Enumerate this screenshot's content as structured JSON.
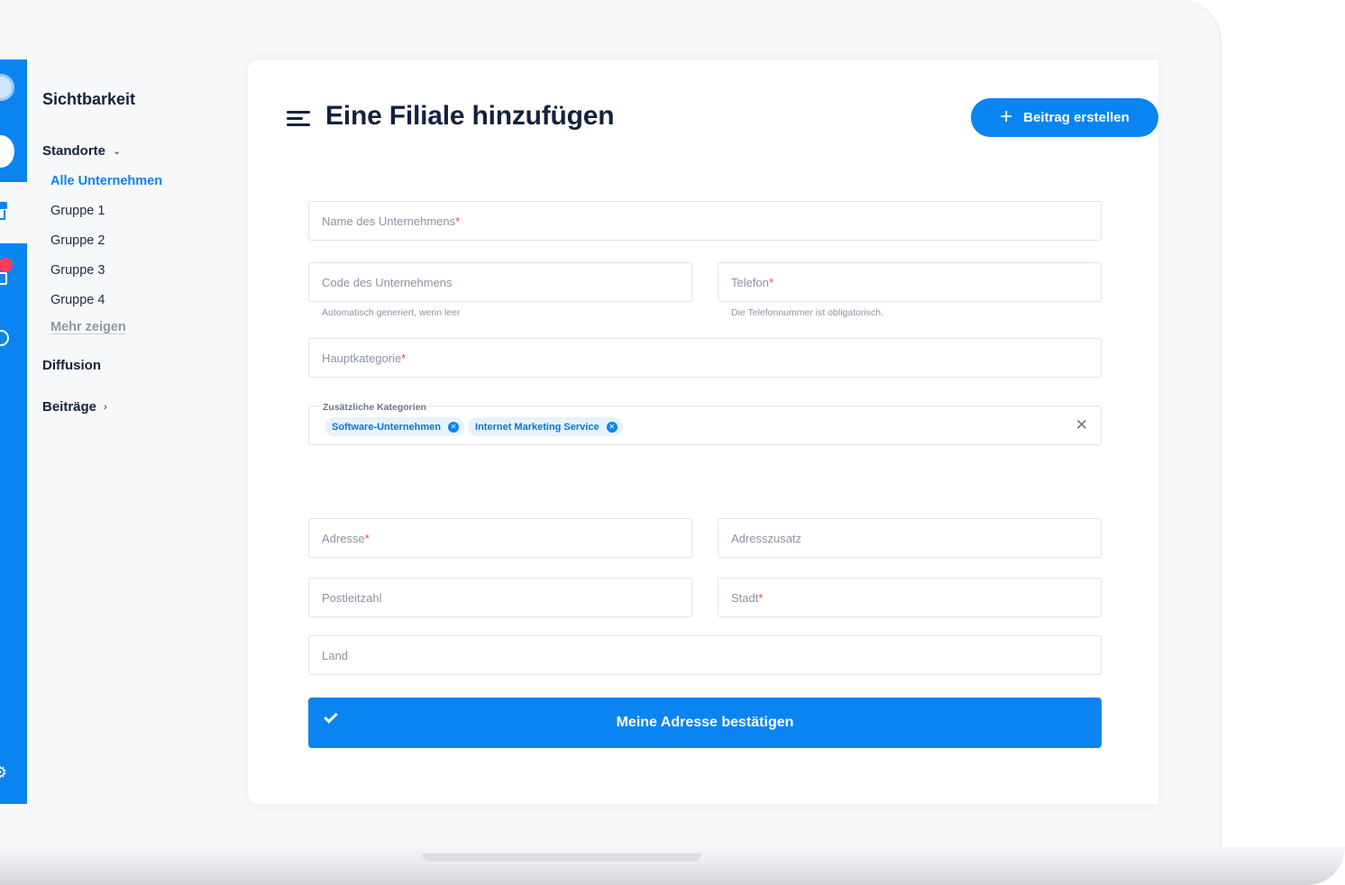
{
  "sidebar": {
    "title": "Sichtbarkeit",
    "standorte_label": "Standorte",
    "items": [
      {
        "label": "Alle Unternehmen"
      },
      {
        "label": "Gruppe 1"
      },
      {
        "label": "Gruppe 2"
      },
      {
        "label": "Gruppe 3"
      },
      {
        "label": "Gruppe 4"
      }
    ],
    "more_label": "Mehr zeigen",
    "diffusion_label": "Diffusion",
    "beitraege_label": "Beiträge"
  },
  "header": {
    "title": "Eine Filiale hinzufügen",
    "create_label": "Beitrag erstellen"
  },
  "form": {
    "company_name_label": "Name des Unternehmens",
    "company_code_label": "Code des  Unternehmens",
    "company_code_hint": "Automatisch generiert, wenn leer",
    "phone_label": "Telefon",
    "phone_hint": "Die Telefonnummer ist obligatorisch.",
    "main_category_label": "Hauptkategorie",
    "additional_categories_label": "Zusätzliche Kategorien",
    "chips": [
      {
        "label": "Software-Unternehmen"
      },
      {
        "label": "Internet Marketing Service"
      }
    ],
    "address_label": "Adresse",
    "address_extra_label": "Adresszusatz",
    "zip_label": "Postleitzahl",
    "city_label": "Stadt",
    "country_label": "Land",
    "required_mark": "*",
    "confirm_label": "Meine Adresse bestätigen"
  },
  "colors": {
    "primary": "#0a84f0",
    "required": "#ff3b5c",
    "text_dark": "#14213d"
  }
}
